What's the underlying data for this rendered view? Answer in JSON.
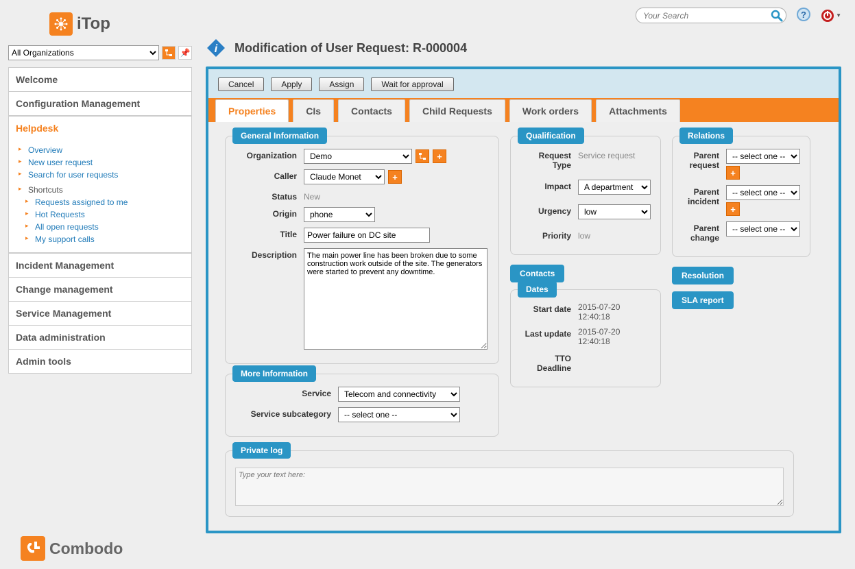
{
  "header": {
    "search_placeholder": "Your Search"
  },
  "org_selector": {
    "value": "All Organizations"
  },
  "nav": {
    "items": [
      "Welcome",
      "Configuration Management",
      "Helpdesk",
      "Incident Management",
      "Change management",
      "Service Management",
      "Data administration",
      "Admin tools"
    ],
    "helpdesk_links": [
      "Overview",
      "New user request",
      "Search for user requests"
    ],
    "shortcuts_label": "Shortcuts",
    "shortcuts": [
      "Requests assigned to me",
      "Hot Requests",
      "All open requests",
      "My support calls"
    ]
  },
  "page": {
    "title": "Modification of User Request: R-000004"
  },
  "actions": {
    "cancel": "Cancel",
    "apply": "Apply",
    "assign": "Assign",
    "wait": "Wait for approval"
  },
  "tabs": [
    "Properties",
    "CIs",
    "Contacts",
    "Child Requests",
    "Work orders",
    "Attachments"
  ],
  "gen": {
    "legend": "General Information",
    "organization_label": "Organization",
    "organization": "Demo",
    "caller_label": "Caller",
    "caller": "Claude Monet",
    "status_label": "Status",
    "status": "New",
    "origin_label": "Origin",
    "origin": "phone",
    "title_label": "Title",
    "title": "Power failure on DC site",
    "description_label": "Description",
    "description": "The main power line has been broken due to some construction work outside of the site. The generators were started to prevent any downtime."
  },
  "more": {
    "legend": "More Information",
    "service_label": "Service",
    "service": "Telecom and connectivity",
    "subcat_label": "Service subcategory",
    "subcat": "-- select one --"
  },
  "qual": {
    "legend": "Qualification",
    "request_type_label": "Request Type",
    "request_type": "Service request",
    "impact_label": "Impact",
    "impact": "A department",
    "urgency_label": "Urgency",
    "urgency": "low",
    "priority_label": "Priority",
    "priority": "low"
  },
  "contacts_pill": "Contacts",
  "dates": {
    "legend": "Dates",
    "start_label": "Start date",
    "start": "2015-07-20 12:40:18",
    "last_label": "Last update",
    "last": "2015-07-20 12:40:18",
    "tto_label": "TTO Deadline"
  },
  "rel": {
    "legend": "Relations",
    "parent_request_label": "Parent request",
    "select_one": "-- select one --",
    "parent_incident_label": "Parent incident",
    "parent_change_label": "Parent change"
  },
  "resolution_pill": "Resolution",
  "sla_pill": "SLA report",
  "privlog": {
    "legend": "Private log",
    "placeholder": "Type your text here:"
  },
  "footer_brand": "Combodo",
  "brand": "iTop"
}
